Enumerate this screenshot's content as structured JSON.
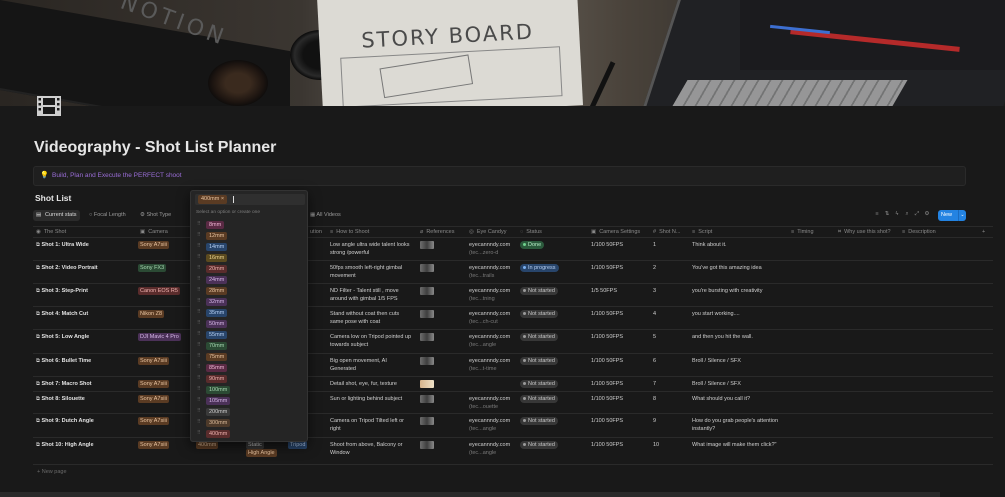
{
  "cover": {
    "notebook_text": "NOTION",
    "storyboard_text": "STORY BOARD"
  },
  "page": {
    "title": "Videography - Shot List Planner",
    "callout": "Build, Plan and Execute the PERFECT shoot"
  },
  "database": {
    "title": "Shot List",
    "views": [
      "Current stats",
      "Focal Length",
      "Shot Type",
      "All Videos"
    ],
    "new_button": "New",
    "new_page": "+ New page",
    "columns": [
      "The Shot",
      "Camera",
      "ution",
      "How to Shoot",
      "References",
      "Eye Candyy",
      "Status",
      "Camera Settings",
      "Shot N...",
      "Script",
      "Timing",
      "Why use this shot?",
      "Description"
    ],
    "rows": [
      {
        "shot": "Shot 1: Ultra Wide",
        "camera": "Sony A7siii",
        "cam_color": "orange",
        "how": "Low angle ultra wide talent looks strong /powerful",
        "eye": "eyecannndy.com",
        "eye_sub": "(tec...zero-d",
        "status": "Done",
        "settings": "1/100 50FPS",
        "num": "1",
        "script": "Think about it."
      },
      {
        "shot": "Shot 2: Video Portrait",
        "camera": "Sony FX3",
        "cam_color": "green",
        "how": "50fps smooth left-right gimbal movement",
        "eye": "eyecannndy.com",
        "eye_sub": "(tec...trails",
        "status": "In progress",
        "settings": "1/100 50FPS",
        "num": "2",
        "script": "You've got this amazing idea"
      },
      {
        "shot": "Shot 3: Step-Print",
        "camera": "Canon EOS R5",
        "cam_color": "red",
        "how": "ND Filter - Talent still , move around with gimbal 1/5 FPS",
        "eye": "eyecannndy.com",
        "eye_sub": "(tec...tning",
        "status": "Not started",
        "settings": "1/5 50FPS",
        "num": "3",
        "script": "you're bursting with creativity"
      },
      {
        "shot": "Shot 4: Match Cut",
        "camera": "Nikon Z8",
        "cam_color": "orange",
        "how": "Stand without coat then cuts same pose with coat",
        "eye": "eyecannndy.com",
        "eye_sub": "(tec...ch-cut",
        "status": "Not started",
        "settings": "1/100 50FPS",
        "num": "4",
        "script": "you start working...."
      },
      {
        "shot": "Shot 5: Low Angle",
        "camera": "DJI Mavic 4 Pro",
        "cam_color": "purple",
        "how": "Camera low on Tripod pointed up towards subject",
        "eye": "eyecannndy.com",
        "eye_sub": "(tec...angle",
        "status": "Not started",
        "settings": "1/100 50FPS",
        "num": "5",
        "script": "and then you hit the wall."
      },
      {
        "shot": "Shot 6: Bullet Time",
        "camera": "Sony A7siii",
        "cam_color": "orange",
        "how": "Big open movement, AI Generated",
        "eye": "eyecannndy.com",
        "eye_sub": "(tec...t-time",
        "status": "Not started",
        "settings": "1/100 50FPS",
        "num": "6",
        "script": "Broll / Silence / SFX"
      },
      {
        "shot": "Shot 7: Macro Shot",
        "camera": "Sony A7siii",
        "cam_color": "orange",
        "how": "Detail shot, eye, fur, texture",
        "eye": "",
        "eye_sub": "",
        "status": "Not started",
        "settings": "1/100 50FPS",
        "num": "7",
        "script": "Broll / Silence / SFX"
      },
      {
        "shot": "Shot 8: Silouette",
        "camera": "Sony A7siii",
        "cam_color": "orange",
        "how": "Sun or lighting behind subject",
        "eye": "eyecannndy.com",
        "eye_sub": "(tec...ouette",
        "status": "Not started",
        "settings": "1/100 50FPS",
        "num": "8",
        "script": "What should you call it?"
      },
      {
        "shot": "Shot 9: Dutch Angle",
        "camera": "Sony A7siii",
        "cam_color": "orange",
        "how": "Camera on Tripod Tilted left or right",
        "eye": "eyecannndy.com",
        "eye_sub": "(tec...angle",
        "status": "Not started",
        "settings": "1/100 50FPS",
        "num": "9",
        "script": "How do you grab people's attention instantly?"
      },
      {
        "shot": "Shot 10: High Angle",
        "camera": "Sony A7siii",
        "cam_color": "orange",
        "how": "Shoot from above, Balcony or Window",
        "eye": "eyecannndy.com",
        "eye_sub": "(tec...angle",
        "status": "Not started",
        "settings": "1/100 50FPS",
        "num": "10",
        "script": "What image will make them click?\""
      }
    ],
    "row10_extra": {
      "focal": "400mm",
      "movement": "Static",
      "movement2": "High Angle",
      "support": "Tripod"
    }
  },
  "dropdown": {
    "selected": "400mm",
    "hint": "Select an option or create one",
    "options": [
      {
        "label": "8mm",
        "color": "pink"
      },
      {
        "label": "12mm",
        "color": "orange"
      },
      {
        "label": "14mm",
        "color": "blue"
      },
      {
        "label": "16mm",
        "color": "yellow"
      },
      {
        "label": "20mm",
        "color": "red"
      },
      {
        "label": "24mm",
        "color": "purple"
      },
      {
        "label": "28mm",
        "color": "orange"
      },
      {
        "label": "32mm",
        "color": "purple"
      },
      {
        "label": "35mm",
        "color": "blue"
      },
      {
        "label": "50mm",
        "color": "purple"
      },
      {
        "label": "55mm",
        "color": "blue"
      },
      {
        "label": "70mm",
        "color": "green"
      },
      {
        "label": "75mm",
        "color": "orange"
      },
      {
        "label": "85mm",
        "color": "pink"
      },
      {
        "label": "90mm",
        "color": "red"
      },
      {
        "label": "100mm",
        "color": "green"
      },
      {
        "label": "105mm",
        "color": "purple"
      },
      {
        "label": "200mm",
        "color": "gray"
      },
      {
        "label": "300mm",
        "color": "brown"
      },
      {
        "label": "400mm",
        "color": "red"
      }
    ]
  }
}
